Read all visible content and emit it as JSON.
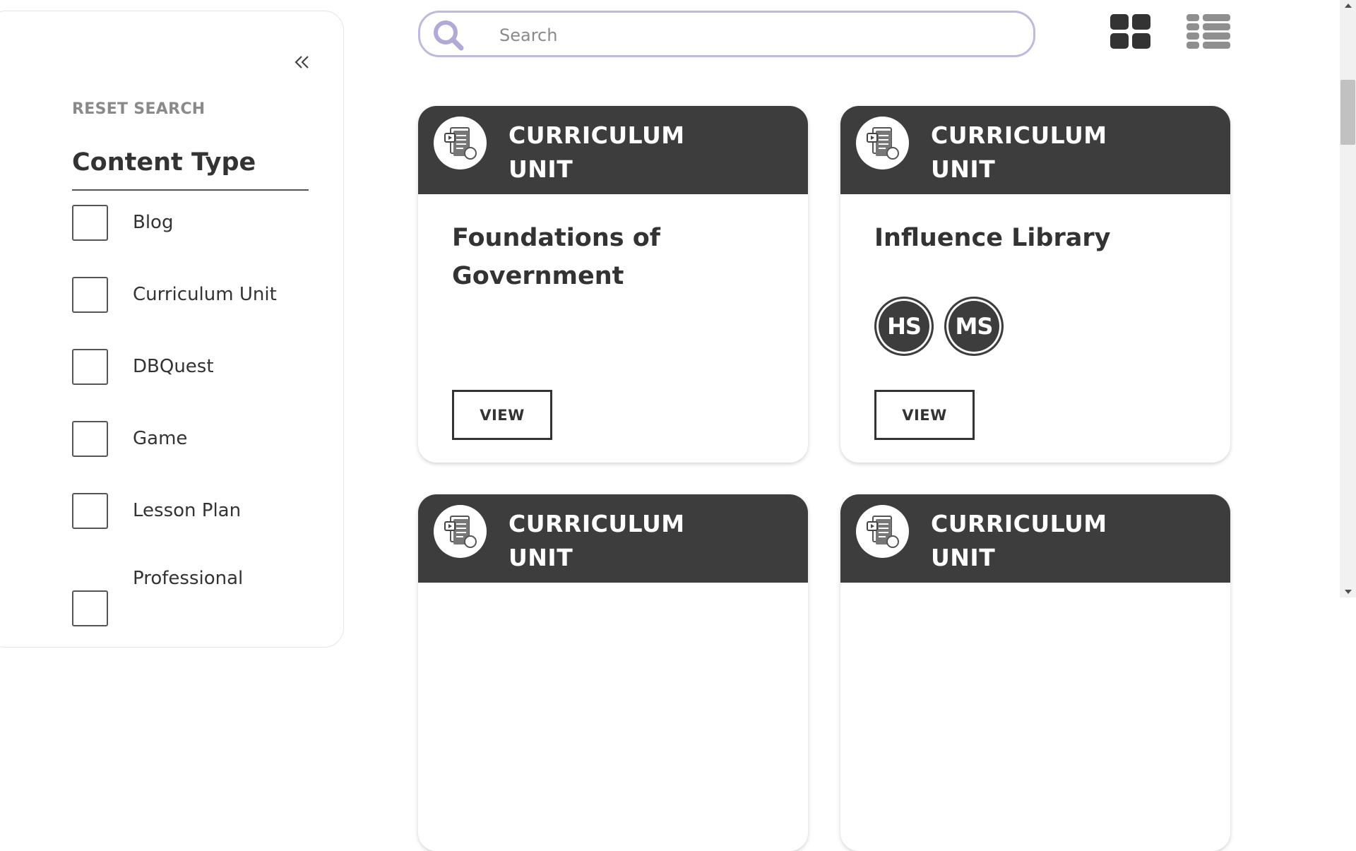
{
  "sidebar": {
    "reset_label": "RESET SEARCH",
    "content_type_title": "Content Type",
    "items": [
      {
        "label": "Blog"
      },
      {
        "label": "Curriculum Unit"
      },
      {
        "label": "DBQuest"
      },
      {
        "label": "Game"
      },
      {
        "label": "Lesson Plan"
      },
      {
        "label": "Professional"
      }
    ]
  },
  "search": {
    "placeholder": "Search",
    "value": ""
  },
  "view_toggles": {
    "grid_icon": "grid-view-icon",
    "list_icon": "list-view-icon"
  },
  "cards": [
    {
      "type_line1": "CURRICULUM",
      "type_line2": "UNIT",
      "title": "Foundations of Government",
      "badges": [],
      "button": "VIEW"
    },
    {
      "type_line1": "CURRICULUM",
      "type_line2": "UNIT",
      "title": "Influence Library",
      "badges": [
        "HS",
        "MS"
      ],
      "button": "VIEW"
    },
    {
      "type_line1": "CURRICULUM",
      "type_line2": "UNIT",
      "title": "",
      "badges": [],
      "button": ""
    },
    {
      "type_line1": "CURRICULUM",
      "type_line2": "UNIT",
      "title": "",
      "badges": [],
      "button": ""
    }
  ],
  "colors": {
    "card_header": "#3d3d3d",
    "search_border": "#c2b7de",
    "text": "#333333",
    "muted": "#8a8a8a"
  }
}
